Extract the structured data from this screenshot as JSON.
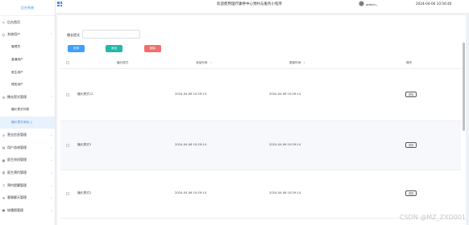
{
  "sidebar": {
    "logo": "后台系统",
    "items": [
      {
        "label": "后台首页",
        "icon": "home-icon"
      },
      {
        "label": "系统用户",
        "icon": "user-icon",
        "caret": "⌃"
      },
      {
        "label": "管理员",
        "sub": true
      },
      {
        "label": "普通用户",
        "sub": true
      },
      {
        "label": "医生用户",
        "sub": true
      },
      {
        "label": "理发用户",
        "sub": true
      },
      {
        "label": "播长提式管理",
        "icon": "gear-icon",
        "caret": "⌃"
      },
      {
        "label": "播长提式列表",
        "sub": true
      },
      {
        "label": "播长提式添加",
        "sub": true,
        "selected": true
      },
      {
        "label": "营业信息管理",
        "icon": "clock-icon",
        "caret": "⌄"
      },
      {
        "label": "用户咨询管理",
        "icon": "chat-icon",
        "caret": "⌄"
      },
      {
        "label": "医生排班管理",
        "icon": "calendar-icon",
        "caret": "⌄"
      },
      {
        "label": "医生预约管理",
        "icon": "list-icon",
        "caret": "⌄"
      },
      {
        "label": "预约提醒管理",
        "icon": "bell-icon",
        "caret": "⌄"
      },
      {
        "label": "客服聊天管理",
        "icon": "chat-icon",
        "caret": "⌄"
      },
      {
        "label": "轮播图管理",
        "icon": "image-icon",
        "caret": "⌄"
      }
    ]
  },
  "topbar": {
    "title": "欢迎使用理疗康养中心预约与服务小程序",
    "user": "admin",
    "user_caret": "⌄",
    "datetime": "2024-04-06 10:56:40"
  },
  "search": {
    "label": "播长提式",
    "value": "",
    "buttons": {
      "query": "查询",
      "add": "添加",
      "delete": "删除"
    }
  },
  "table": {
    "headers": [
      "播长提式",
      "添加时间",
      "更新时间",
      "操作"
    ],
    "sort_icon": "⇕",
    "rows": [
      {
        "name": "播长提式12",
        "created": "2024-04-06 10:29:14",
        "updated": "2024-04-06 10:29:14",
        "action": "详情"
      },
      {
        "name": "播长提式3",
        "created": "2024-04-06 10:29:14",
        "updated": "2024-04-06 10:29:14",
        "action": "详情"
      },
      {
        "name": "播长提式2",
        "created": "2024-04-06 10:29:14",
        "updated": "2024-04-06 10:29:14",
        "action": "详情"
      }
    ]
  },
  "watermark": "CSDN @MZ_ZXD001"
}
